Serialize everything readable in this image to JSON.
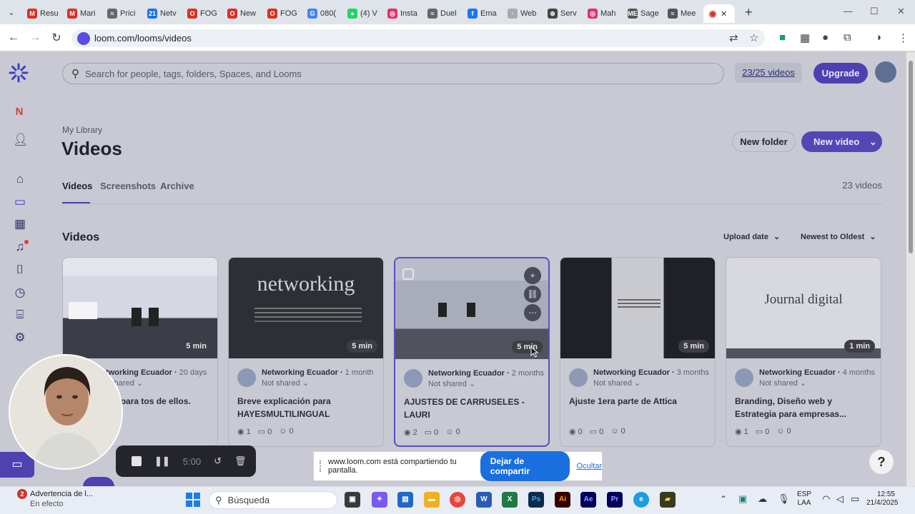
{
  "browser": {
    "tabs": [
      {
        "label": "Resu",
        "color": "#d93025",
        "glyph": "M"
      },
      {
        "label": "Mari",
        "color": "#d93025",
        "glyph": "M"
      },
      {
        "label": "Prici",
        "color": "#666666",
        "glyph": "≈"
      },
      {
        "label": "Netv",
        "color": "#1a73e8",
        "glyph": "21"
      },
      {
        "label": "FOG",
        "color": "#d93025",
        "glyph": "O"
      },
      {
        "label": "New",
        "color": "#d93025",
        "glyph": "O"
      },
      {
        "label": "FOG",
        "color": "#d93025",
        "glyph": "O"
      },
      {
        "label": "080(",
        "color": "#4285f4",
        "glyph": "G"
      },
      {
        "label": "(4) V",
        "color": "#25d366",
        "glyph": "●"
      },
      {
        "label": "Insta",
        "color": "#e1306c",
        "glyph": "◎"
      },
      {
        "label": "Duel",
        "color": "#666666",
        "glyph": "≈"
      },
      {
        "label": "Ema",
        "color": "#1877f2",
        "glyph": "f"
      },
      {
        "label": "Web",
        "color": "#aaaaaa",
        "glyph": "·"
      },
      {
        "label": "Serv",
        "color": "#444444",
        "glyph": "⊕"
      },
      {
        "label": "Mah",
        "color": "#e1306c",
        "glyph": "◎"
      },
      {
        "label": "Sage",
        "color": "#555555",
        "glyph": "ME"
      },
      {
        "label": "Mee",
        "color": "#555555",
        "glyph": "≈"
      }
    ],
    "active_tab": {
      "label": "V",
      "glyph": "◉"
    },
    "new_tab": "+",
    "url": "loom.com/looms/videos",
    "window": {
      "minimize": "—",
      "maximize": "☐",
      "close": "✕"
    }
  },
  "header": {
    "search_placeholder": "Search for people, tags, folders, Spaces, and Looms",
    "quota": "23/25 videos",
    "upgrade": "Upgrade"
  },
  "sidebar": {
    "workspace_initial": "N",
    "items": [
      "add-user",
      "home",
      "library",
      "calendar",
      "notifications",
      "bookmarks",
      "history",
      "gift",
      "settings"
    ]
  },
  "library": {
    "breadcrumb": "My Library",
    "title": "Videos",
    "new_folder": "New folder",
    "new_video": "New video",
    "tabs": [
      "Videos",
      "Screenshots",
      "Archive"
    ],
    "count": "23 videos",
    "section_title": "Videos",
    "sort_by": "Upload date",
    "sort_order": "Newest to Oldest"
  },
  "videos": [
    {
      "owner": "Networking Ecuador",
      "age": "20 days",
      "shared": "Not shared",
      "title": "s de videos para tos de ellos.",
      "duration": "5 min",
      "views": "",
      "comments": "",
      "reactions": "0"
    },
    {
      "owner": "Networking Ecuador",
      "age": "1 month",
      "shared": "Not shared",
      "title": "Breve explicación para HAYESMULTILINGUAL",
      "duration": "5 min",
      "views": "1",
      "comments": "0",
      "reactions": "0"
    },
    {
      "owner": "Networking Ecuador",
      "age": "2 months",
      "shared": "Not shared",
      "title": "AJUSTES DE CARRUSELES - LAURI",
      "duration": "5 min",
      "views": "2",
      "comments": "0",
      "reactions": "0"
    },
    {
      "owner": "Networking Ecuador",
      "age": "3 months",
      "shared": "Not shared",
      "title": "Ajuste 1era parte de Attica",
      "duration": "5 min",
      "views": "0",
      "comments": "0",
      "reactions": "0"
    },
    {
      "owner": "Networking Ecuador",
      "age": "4 months",
      "shared": "Not shared",
      "title": "Branding, Diseño web y Estrategia para empresas...",
      "duration": "1 min",
      "views": "1",
      "comments": "0",
      "reactions": "0"
    }
  ],
  "thumbnails": {
    "networking_word": "networking",
    "journal_word": "Journal digital"
  },
  "recorder": {
    "time": "5:00"
  },
  "share_banner": {
    "message": "www.loom.com está compartiendo tu pantalla.",
    "stop": "Dejar de compartir",
    "hide": "Ocultar"
  },
  "help": "?",
  "taskbar": {
    "notification_title": "Advertencia de l...",
    "notification_sub": "En efecto",
    "notification_badge": "2",
    "search": "Búsqueda",
    "lang_top": "ESP",
    "lang_bottom": "LAA",
    "time": "12:55",
    "date": "21/4/2025"
  },
  "colors": {
    "brand": "#5546b6",
    "overlay_bg": "#c8c9d2",
    "share_button": "#1a6fde"
  }
}
